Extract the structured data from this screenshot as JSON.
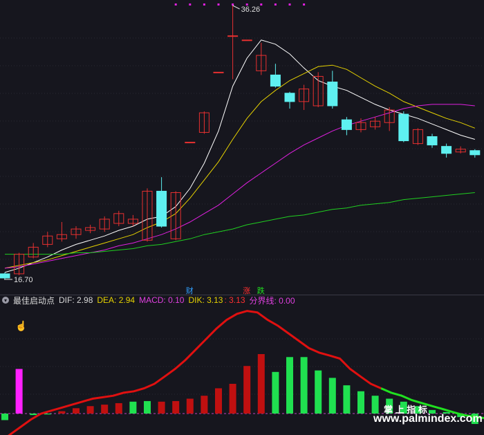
{
  "chart_data": {
    "type": "candlestick",
    "price_panel": {
      "high_label": "36.26",
      "low_label": "16.70",
      "candles": [
        {
          "o": 17.1,
          "c": 16.8,
          "h": 17.2,
          "l": 16.7,
          "dir": "down"
        },
        {
          "o": 17.1,
          "c": 18.5,
          "h": 18.6,
          "l": 17.0,
          "dir": "up"
        },
        {
          "o": 18.3,
          "c": 19.0,
          "h": 19.3,
          "l": 18.2,
          "dir": "up"
        },
        {
          "o": 19.2,
          "c": 19.8,
          "h": 20.1,
          "l": 19.0,
          "dir": "up"
        },
        {
          "o": 19.6,
          "c": 19.9,
          "h": 20.8,
          "l": 19.4,
          "dir": "up"
        },
        {
          "o": 19.9,
          "c": 20.3,
          "h": 20.5,
          "l": 19.6,
          "dir": "up"
        },
        {
          "o": 20.2,
          "c": 20.4,
          "h": 20.6,
          "l": 20.0,
          "dir": "up"
        },
        {
          "o": 20.3,
          "c": 21.0,
          "h": 21.2,
          "l": 20.1,
          "dir": "up"
        },
        {
          "o": 20.7,
          "c": 21.4,
          "h": 21.6,
          "l": 20.5,
          "dir": "up"
        },
        {
          "o": 20.7,
          "c": 21.0,
          "h": 21.3,
          "l": 20.5,
          "dir": "up"
        },
        {
          "o": 19.5,
          "c": 23.0,
          "h": 23.2,
          "l": 19.4,
          "dir": "up"
        },
        {
          "o": 23.0,
          "c": 20.5,
          "h": 24.0,
          "l": 20.4,
          "dir": "down"
        },
        {
          "o": 19.6,
          "c": 22.9,
          "h": 23.0,
          "l": 19.5,
          "dir": "up"
        },
        {
          "o": 26.5,
          "c": 26.5,
          "h": 26.5,
          "l": 26.5,
          "dir": "up"
        },
        {
          "o": 27.2,
          "c": 28.6,
          "h": 28.7,
          "l": 27.1,
          "dir": "up"
        },
        {
          "o": 31.5,
          "c": 31.5,
          "h": 31.5,
          "l": 31.5,
          "dir": "up"
        },
        {
          "o": 34.1,
          "c": 34.1,
          "h": 36.26,
          "l": 31.0,
          "dir": "up"
        },
        {
          "o": 33.8,
          "c": 33.8,
          "h": 33.8,
          "l": 33.8,
          "dir": "up"
        },
        {
          "o": 31.6,
          "c": 32.7,
          "h": 33.6,
          "l": 31.3,
          "dir": "up"
        },
        {
          "o": 31.3,
          "c": 30.5,
          "h": 32.1,
          "l": 30.4,
          "dir": "down"
        },
        {
          "o": 30.0,
          "c": 29.4,
          "h": 30.1,
          "l": 28.9,
          "dir": "down"
        },
        {
          "o": 29.4,
          "c": 30.3,
          "h": 30.6,
          "l": 28.8,
          "dir": "up"
        },
        {
          "o": 29.1,
          "c": 31.2,
          "h": 31.5,
          "l": 29.0,
          "dir": "up"
        },
        {
          "o": 30.8,
          "c": 29.1,
          "h": 31.6,
          "l": 28.9,
          "dir": "down"
        },
        {
          "o": 28.1,
          "c": 27.4,
          "h": 28.3,
          "l": 27.0,
          "dir": "down"
        },
        {
          "o": 27.4,
          "c": 27.9,
          "h": 28.2,
          "l": 27.2,
          "dir": "up"
        },
        {
          "o": 27.6,
          "c": 28.0,
          "h": 28.3,
          "l": 27.4,
          "dir": "up"
        },
        {
          "o": 27.9,
          "c": 28.8,
          "h": 29.0,
          "l": 27.3,
          "dir": "up"
        },
        {
          "o": 28.5,
          "c": 26.6,
          "h": 28.7,
          "l": 26.5,
          "dir": "down"
        },
        {
          "o": 26.4,
          "c": 27.4,
          "h": 27.5,
          "l": 26.3,
          "dir": "up"
        },
        {
          "o": 26.9,
          "c": 26.3,
          "h": 27.1,
          "l": 26.1,
          "dir": "down"
        },
        {
          "o": 26.2,
          "c": 25.7,
          "h": 26.4,
          "l": 25.4,
          "dir": "down"
        },
        {
          "o": 25.8,
          "c": 26.0,
          "h": 26.2,
          "l": 25.7,
          "dir": "up"
        },
        {
          "o": 25.9,
          "c": 25.6,
          "h": 26.0,
          "l": 25.4,
          "dir": "down"
        }
      ],
      "ma_lines": [
        {
          "color": "#ffffff",
          "values": [
            17.2,
            17.5,
            17.9,
            18.3,
            18.8,
            19.2,
            19.5,
            19.8,
            20.2,
            20.5,
            21.0,
            21.2,
            21.9,
            23.2,
            25.0,
            27.3,
            30.5,
            32.5,
            33.8,
            33.5,
            32.8,
            31.8,
            30.9,
            30.5,
            30.2,
            29.7,
            29.2,
            28.8,
            28.5,
            28.2,
            27.8,
            27.4,
            27.0,
            26.7
          ]
        },
        {
          "color": "#e6d200",
          "values": [
            17.5,
            17.7,
            17.9,
            18.1,
            18.4,
            18.7,
            19.0,
            19.3,
            19.6,
            19.9,
            20.4,
            20.8,
            21.4,
            22.5,
            23.8,
            25.1,
            26.7,
            28.2,
            29.4,
            30.2,
            30.9,
            31.4,
            31.9,
            32.0,
            31.7,
            31.1,
            30.5,
            30.0,
            29.4,
            29.0,
            28.6,
            28.2,
            27.9,
            27.5
          ]
        },
        {
          "color": "#e020e0",
          "values": [
            17.5,
            17.6,
            17.8,
            18.0,
            18.2,
            18.4,
            18.6,
            18.8,
            19.1,
            19.3,
            19.6,
            19.9,
            20.3,
            20.8,
            21.4,
            22.0,
            22.8,
            23.6,
            24.3,
            25.0,
            25.7,
            26.3,
            26.8,
            27.3,
            27.7,
            28.0,
            28.3,
            28.6,
            28.9,
            29.1,
            29.2,
            29.2,
            29.2,
            29.1
          ]
        },
        {
          "color": "#20d020",
          "values": [
            18.5,
            18.5,
            18.5,
            18.5,
            18.5,
            18.6,
            18.6,
            18.7,
            18.8,
            18.9,
            19.1,
            19.2,
            19.4,
            19.6,
            19.9,
            20.1,
            20.3,
            20.6,
            20.8,
            21.0,
            21.2,
            21.3,
            21.5,
            21.7,
            21.8,
            22.0,
            22.1,
            22.2,
            22.4,
            22.5,
            22.6,
            22.7,
            22.8,
            22.9
          ]
        }
      ],
      "top_markers": [
        12,
        13,
        14,
        15,
        16,
        17,
        18,
        19,
        20,
        21
      ]
    },
    "signals": [
      {
        "index": 13,
        "text": "财",
        "color": "#30a0ff"
      },
      {
        "index": 17,
        "text": "涨",
        "color": "#ff3030"
      },
      {
        "index": 18,
        "text": "跌",
        "color": "#20e020"
      }
    ],
    "indicator": {
      "name": "最佳启动点",
      "labels": [
        {
          "text": "DIF: 2.98",
          "color": "#d8d8d8"
        },
        {
          "text": "DEA: 2.94",
          "color": "#e6d200"
        },
        {
          "text": "MACD: 0.10",
          "color": "#e040e0"
        },
        {
          "text": "DIK: 3.13",
          "color": "#e6d200"
        },
        {
          "text": ": 3.13",
          "color": "#ff3030"
        },
        {
          "text": "分界线: 0.00",
          "color": "#e040e0"
        }
      ],
      "histogram": [
        -0.22,
        1.5,
        -0.05,
        -0.03,
        0.08,
        0.18,
        0.25,
        0.3,
        0.35,
        0.4,
        0.42,
        0.4,
        0.42,
        0.5,
        0.6,
        0.85,
        1.0,
        1.6,
        2.0,
        1.4,
        1.9,
        1.9,
        1.45,
        1.2,
        0.95,
        0.75,
        0.6,
        0.5,
        0.4,
        0.25,
        0.12,
        0.05,
        -0.12,
        -0.35
      ],
      "bar_colors": [
        "#20e050",
        "#ff20ff",
        "#20e050",
        "#20e050",
        "#c01010",
        "#c01010",
        "#c01010",
        "#c01010",
        "#c01010",
        "#20e050",
        "#20e050",
        "#c01010",
        "#c01010",
        "#c01010",
        "#c01010",
        "#c01010",
        "#c01010",
        "#c01010",
        "#c01010",
        "#20e050",
        "#20e050",
        "#20e050",
        "#20e050",
        "#20e050",
        "#20e050",
        "#20e050",
        "#20e050",
        "#20e050",
        "#20e050",
        "#20e050",
        "#20e050",
        "#20e050",
        "#20e050",
        "#20e050"
      ],
      "line": [
        -0.95,
        -0.7,
        -0.45,
        -0.2,
        0.0,
        0.1,
        0.2,
        0.3,
        0.4,
        0.5,
        0.55,
        0.6,
        0.7,
        0.75,
        0.85,
        1.0,
        1.25,
        1.5,
        1.8,
        2.15,
        2.5,
        2.85,
        3.15,
        3.35,
        3.45,
        3.4,
        3.15,
        2.95,
        2.7,
        2.45,
        2.2,
        2.05,
        1.95,
        1.85,
        1.5,
        1.25,
        1.0,
        0.85,
        0.7,
        0.6,
        0.45,
        0.35,
        0.25,
        0.15,
        0.05,
        -0.05,
        -0.1,
        -0.15
      ],
      "line_split_index": 26,
      "line_colors": [
        "#e01010",
        "#20e020"
      ]
    }
  },
  "watermark": {
    "line1": "掌 上 指 标",
    "line2": "www.palmindex.com"
  }
}
